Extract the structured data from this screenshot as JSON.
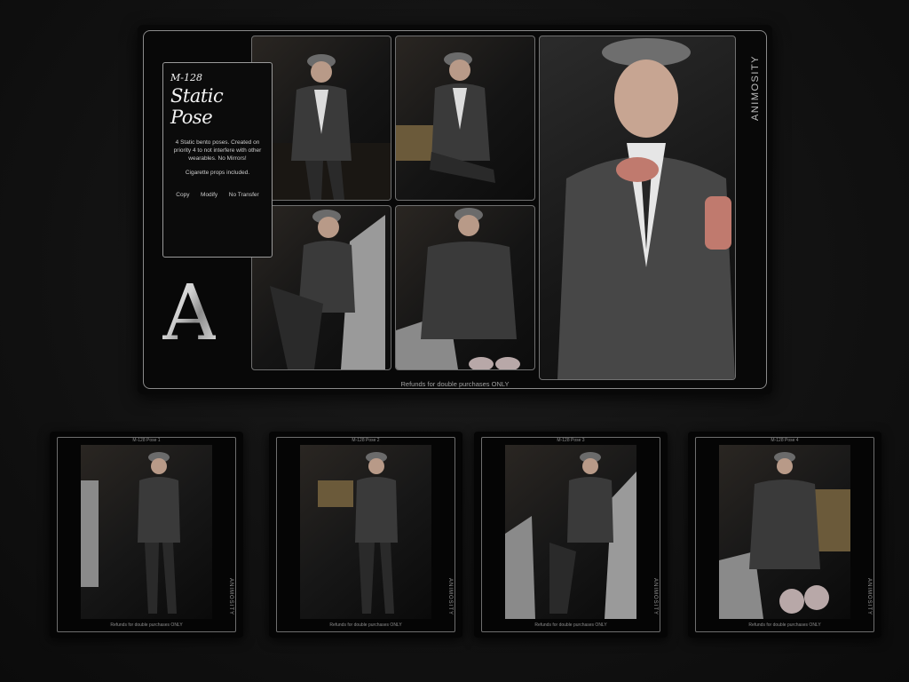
{
  "main_card": {
    "sku": "M-128",
    "title": "Static Pose",
    "description": "4 Static bento poses. Created on priority 4 to not interfere with other wearables. No Mirrors!",
    "props_note": "Cigarette props included.",
    "permissions": [
      "Copy",
      "Modify",
      "No Transfer"
    ],
    "brand_letter": "A",
    "brand_name": "ANIMOSITY",
    "refund_note": "Refunds for double purchases ONLY"
  },
  "thumbnails": [
    {
      "label": "M-128 Pose 1",
      "refund_note": "Refunds for double purchases ONLY",
      "brand_name": "ANIMOSITY"
    },
    {
      "label": "M-128 Pose 2",
      "refund_note": "Refunds for double purchases ONLY",
      "brand_name": "ANIMOSITY"
    },
    {
      "label": "M-128 Pose 3",
      "refund_note": "Refunds for double purchases ONLY",
      "brand_name": "ANIMOSITY"
    },
    {
      "label": "M-128 Pose 4",
      "refund_note": "Refunds for double purchases ONLY",
      "brand_name": "ANIMOSITY"
    }
  ]
}
